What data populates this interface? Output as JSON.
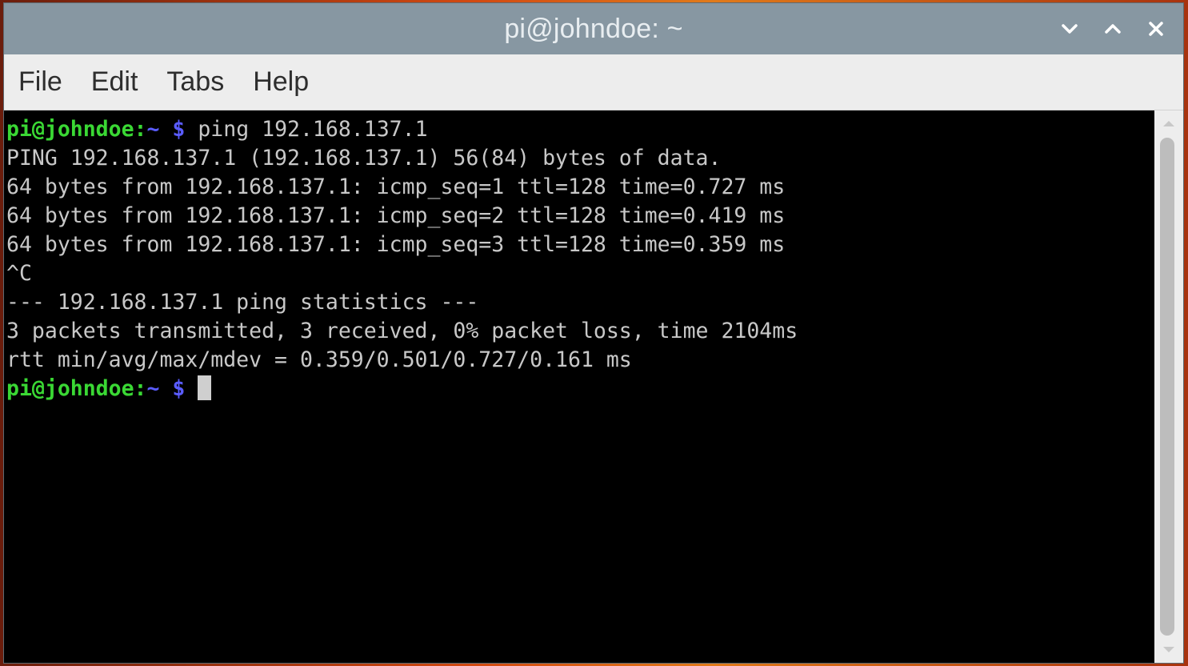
{
  "window": {
    "title": "pi@johndoe: ~",
    "controls": [
      "minimize-icon",
      "maximize-icon",
      "close-icon"
    ]
  },
  "menu": {
    "items": [
      "File",
      "Edit",
      "Tabs",
      "Help"
    ]
  },
  "terminal": {
    "prompt": {
      "user_host": "pi@johndoe",
      "colon": ":",
      "path": "~ $",
      "command": " ping 192.168.137.1"
    },
    "output": [
      "PING 192.168.137.1 (192.168.137.1) 56(84) bytes of data.",
      "64 bytes from 192.168.137.1: icmp_seq=1 ttl=128 time=0.727 ms",
      "64 bytes from 192.168.137.1: icmp_seq=2 ttl=128 time=0.419 ms",
      "64 bytes from 192.168.137.1: icmp_seq=3 ttl=128 time=0.359 ms",
      "^C",
      "--- 192.168.137.1 ping statistics ---",
      "3 packets transmitted, 3 received, 0% packet loss, time 2104ms",
      "rtt min/avg/max/mdev = 0.359/0.501/0.727/0.161 ms"
    ],
    "final_prompt": {
      "user_host": "pi@johndoe",
      "colon": ":",
      "path": "~ $",
      "command": " "
    }
  },
  "colors": {
    "titlebar": "#8797a2",
    "prompt_user": "#3ad834",
    "prompt_path": "#5a5cff",
    "terminal_bg": "#000000",
    "terminal_fg": "#c8c8c8"
  }
}
